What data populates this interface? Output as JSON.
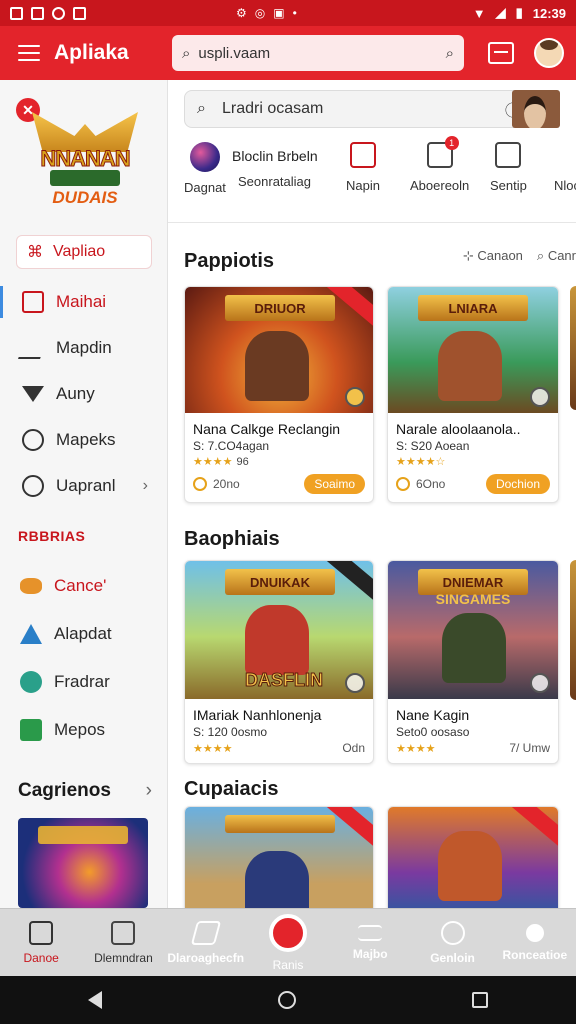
{
  "status": {
    "time": "12:39",
    "battery_icon": "battery-icon",
    "wifi_icon": "wifi-icon",
    "signal_icon": "signal-icon"
  },
  "appbar": {
    "title": "Apliaka",
    "search_value": "uspli.vaam",
    "colors": {
      "primary": "#e3242b",
      "dark": "#c8161d"
    }
  },
  "sidebar": {
    "logo_text": "NNANAN",
    "logo_sub": "DUDAIS",
    "selected_label": "Vapliao",
    "items": [
      {
        "label": "Maihai",
        "icon": "image-icon"
      },
      {
        "label": "Mapdin",
        "icon": "pen-icon"
      },
      {
        "label": "Auny",
        "icon": "funnel-icon"
      },
      {
        "label": "Mapeks",
        "icon": "target-icon"
      },
      {
        "label": "Uapranl",
        "icon": "user-circle-icon"
      }
    ],
    "heading": "RBBRIAS",
    "categories": [
      {
        "label": "Cance'",
        "icon": "controller-icon"
      },
      {
        "label": "Alapdat",
        "icon": "tree-icon"
      },
      {
        "label": "Fradrar",
        "icon": "globe-icon"
      },
      {
        "label": "Mepos",
        "icon": "map-icon"
      }
    ],
    "categories_title": "Cagrienos"
  },
  "main": {
    "search_placeholder": "Lradri ocasam",
    "quick": [
      {
        "label": "Dagnat"
      },
      {
        "label": "Bloclin Brbeln",
        "sub": "Seonrataliag"
      },
      {
        "label": "Napin"
      },
      {
        "label": "Aboereoln",
        "badge": "1"
      },
      {
        "label": "Sentip"
      },
      {
        "label": "Nloc"
      }
    ],
    "sections": [
      {
        "title": "Pappiotis",
        "actions": [
          "Canaon",
          "Canr"
        ],
        "cards": [
          {
            "art_title": "DRIUOR",
            "title": "Nana Calkge Reclangin",
            "sub": "S: 7.CO4agan",
            "stars": "★★★★",
            "rating": "96",
            "coins": "20no",
            "pill": "Soaimo"
          },
          {
            "art_title": "LNIARA",
            "title": "Narale aloolaanola..",
            "sub": "S: S20 Aoean",
            "stars": "★★★★☆",
            "rating": "",
            "coins": "6Ono",
            "pill": "Dochion"
          }
        ]
      },
      {
        "title": "Baophiais",
        "cards": [
          {
            "art_title": "DNUIKAK",
            "title": "IMariak Nanhlonenja",
            "sub": "S: 120 0osmo",
            "stars": "★★★★",
            "rating": "Odn",
            "art_bottom": "DASFLIN"
          },
          {
            "art_title": "DNIEMAR",
            "title": "Nane Kagin",
            "sub": "Seto0 oosaso",
            "stars": "★★★★",
            "rating": "7/ Umw",
            "art_bottom": "SINGAMES"
          }
        ]
      },
      {
        "title": "Cupaiacis"
      }
    ]
  },
  "bottomnav": [
    {
      "label": "Danoe",
      "icon": "home-icon",
      "active": true
    },
    {
      "label": "Dlemndran",
      "icon": "notebook-icon"
    },
    {
      "label": "Dlaroaghecfn",
      "icon": "cart-icon"
    },
    {
      "label": "Ranis",
      "icon": "alarm-icon"
    },
    {
      "label": "Majbo",
      "icon": "menu-icon"
    },
    {
      "label": "Genloin",
      "icon": "compass-icon"
    },
    {
      "label": "Ronceatioe",
      "icon": "person-icon"
    }
  ]
}
